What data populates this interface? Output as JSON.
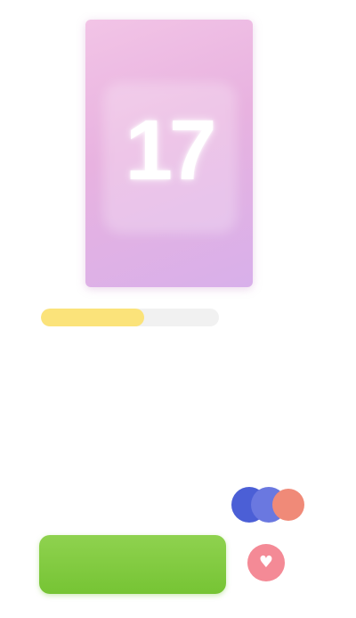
{
  "product": {
    "cover": {
      "number": "17",
      "colors": {
        "top": "#f2c4e6",
        "middle": "#e8b2e0",
        "bottom": "#d8b0ea"
      }
    },
    "rating": {
      "fraction": 0.58,
      "fill_color": "#fbe37a",
      "track_color": "#f1f1f1"
    },
    "title": "",
    "subtitle": ""
  },
  "purchase": {
    "price_label": "",
    "price": "",
    "buy_label": "",
    "buy_color": "#7ac738",
    "wishlist_icon": "heart-icon",
    "wishlist_color": "#f48a96"
  },
  "payment_icons": [
    {
      "name": "card-icon",
      "color": "#4b5fd6"
    },
    {
      "name": "card-icon",
      "color": "#6a78e0"
    },
    {
      "name": "card-icon",
      "color": "#f08a78"
    }
  ]
}
